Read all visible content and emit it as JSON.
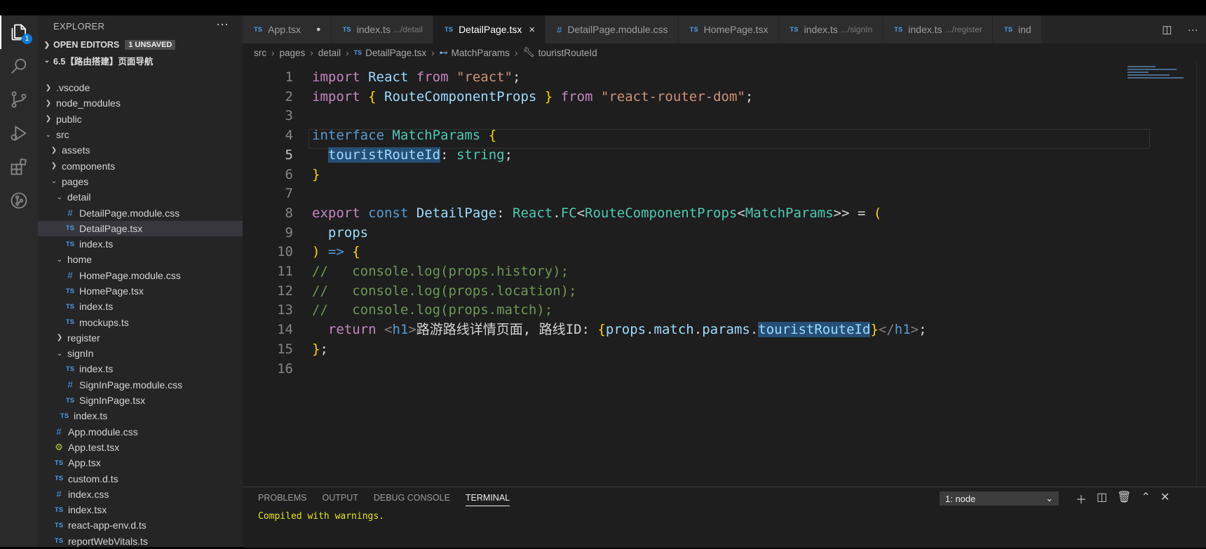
{
  "activity": {
    "badge": "1"
  },
  "sidebar": {
    "title": "EXPLORER",
    "more": "···",
    "open_editors": "OPEN EDITORS",
    "unsaved": "1 UNSAVED",
    "project": "6.5【路由搭建】页面导航",
    "tree": [
      {
        "label": ".vscode",
        "type": "folder",
        "open": false,
        "depth": 1
      },
      {
        "label": "node_modules",
        "type": "folder",
        "open": false,
        "depth": 1
      },
      {
        "label": "public",
        "type": "folder",
        "open": false,
        "depth": 1
      },
      {
        "label": "src",
        "type": "folder",
        "open": true,
        "depth": 1
      },
      {
        "label": "assets",
        "type": "folder",
        "open": false,
        "depth": 2
      },
      {
        "label": "components",
        "type": "folder",
        "open": false,
        "depth": 2
      },
      {
        "label": "pages",
        "type": "folder",
        "open": true,
        "depth": 2
      },
      {
        "label": "detail",
        "type": "folder",
        "open": true,
        "depth": 3
      },
      {
        "label": "DetailPage.module.css",
        "type": "css",
        "depth": 4
      },
      {
        "label": "DetailPage.tsx",
        "type": "ts",
        "depth": 4,
        "selected": true
      },
      {
        "label": "index.ts",
        "type": "ts",
        "depth": 4
      },
      {
        "label": "home",
        "type": "folder",
        "open": true,
        "depth": 3
      },
      {
        "label": "HomePage.module.css",
        "type": "css",
        "depth": 4
      },
      {
        "label": "HomePage.tsx",
        "type": "ts",
        "depth": 4
      },
      {
        "label": "index.ts",
        "type": "ts",
        "depth": 4
      },
      {
        "label": "mockups.ts",
        "type": "ts",
        "depth": 4
      },
      {
        "label": "register",
        "type": "folder",
        "open": false,
        "depth": 3
      },
      {
        "label": "signIn",
        "type": "folder",
        "open": true,
        "depth": 3
      },
      {
        "label": "index.ts",
        "type": "ts",
        "depth": 4
      },
      {
        "label": "SignInPage.module.css",
        "type": "css",
        "depth": 4
      },
      {
        "label": "SignInPage.tsx",
        "type": "ts",
        "depth": 4
      },
      {
        "label": "index.ts",
        "type": "ts",
        "depth": 3
      },
      {
        "label": "App.module.css",
        "type": "css",
        "depth": 2
      },
      {
        "label": "App.test.tsx",
        "type": "test",
        "depth": 2
      },
      {
        "label": "App.tsx",
        "type": "ts",
        "depth": 2
      },
      {
        "label": "custom.d.ts",
        "type": "ts",
        "depth": 2
      },
      {
        "label": "index.css",
        "type": "css",
        "depth": 2
      },
      {
        "label": "index.tsx",
        "type": "ts",
        "depth": 2
      },
      {
        "label": "react-app-env.d.ts",
        "type": "ts",
        "depth": 2
      },
      {
        "label": "reportWebVitals.ts",
        "type": "ts",
        "depth": 2
      }
    ]
  },
  "tabs": [
    {
      "label": "App.tsx",
      "icon": "TS",
      "sub": "",
      "dirty": true,
      "active": false
    },
    {
      "label": "index.ts",
      "icon": "TS",
      "sub": ".../detail",
      "active": false
    },
    {
      "label": "DetailPage.tsx",
      "icon": "TS",
      "sub": "",
      "active": true,
      "close": "×"
    },
    {
      "label": "DetailPage.module.css",
      "icon": "#",
      "sub": "",
      "active": false
    },
    {
      "label": "HomePage.tsx",
      "icon": "TS",
      "sub": "",
      "active": false
    },
    {
      "label": "index.ts",
      "icon": "TS",
      "sub": ".../signIn",
      "active": false
    },
    {
      "label": "index.ts",
      "icon": "TS",
      "sub": ".../register",
      "active": false
    },
    {
      "label": "ind",
      "icon": "TS",
      "sub": "",
      "active": false
    }
  ],
  "breadcrumb": {
    "items": [
      "src",
      "pages",
      "detail"
    ],
    "file_icon": "TS",
    "file": "DetailPage.tsx",
    "symbol": "MatchParams",
    "property": "touristRouteId"
  },
  "code": {
    "current_line": 5,
    "lines": [
      [
        [
          "kw2",
          "import"
        ],
        [
          "pn",
          " "
        ],
        [
          "vr",
          "React"
        ],
        [
          "pn",
          " "
        ],
        [
          "kw2",
          "from"
        ],
        [
          "pn",
          " "
        ],
        [
          "st",
          "\"react\""
        ],
        [
          "pn",
          ";"
        ]
      ],
      [
        [
          "kw2",
          "import"
        ],
        [
          "pn",
          " "
        ],
        [
          "br",
          "{"
        ],
        [
          "pn",
          " "
        ],
        [
          "vr",
          "RouteComponentProps"
        ],
        [
          "pn",
          " "
        ],
        [
          "br",
          "}"
        ],
        [
          "pn",
          " "
        ],
        [
          "kw2",
          "from"
        ],
        [
          "pn",
          " "
        ],
        [
          "st",
          "\"react-router-dom\""
        ],
        [
          "pn",
          ";"
        ]
      ],
      [],
      [
        [
          "kw",
          "interface"
        ],
        [
          "pn",
          " "
        ],
        [
          "ty",
          "MatchParams"
        ],
        [
          "pn",
          " "
        ],
        [
          "br",
          "{"
        ]
      ],
      [
        [
          "pn",
          "  "
        ],
        [
          "vr hl",
          "touristRouteId"
        ],
        [
          "pn",
          ": "
        ],
        [
          "ty",
          "string"
        ],
        [
          "pn",
          ";"
        ]
      ],
      [
        [
          "br",
          "}"
        ]
      ],
      [],
      [
        [
          "kw2",
          "export"
        ],
        [
          "pn",
          " "
        ],
        [
          "kw",
          "const"
        ],
        [
          "pn",
          " "
        ],
        [
          "vr",
          "DetailPage"
        ],
        [
          "pn",
          ": "
        ],
        [
          "ty",
          "React"
        ],
        [
          "pn",
          "."
        ],
        [
          "ty",
          "FC"
        ],
        [
          "pn",
          "<"
        ],
        [
          "ty",
          "RouteComponentProps"
        ],
        [
          "pn",
          "<"
        ],
        [
          "ty",
          "MatchParams"
        ],
        [
          "pn",
          ">> = "
        ],
        [
          "br",
          "("
        ]
      ],
      [
        [
          "pn",
          "  "
        ],
        [
          "vr",
          "props"
        ]
      ],
      [
        [
          "br",
          ")"
        ],
        [
          "pn",
          " "
        ],
        [
          "kw",
          "=>"
        ],
        [
          "pn",
          " "
        ],
        [
          "br",
          "{"
        ]
      ],
      [
        [
          "cm",
          "//   console.log(props.history);"
        ]
      ],
      [
        [
          "cm",
          "//   console.log(props.location);"
        ]
      ],
      [
        [
          "cm",
          "//   console.log(props.match);"
        ]
      ],
      [
        [
          "pn",
          "  "
        ],
        [
          "kw2",
          "return"
        ],
        [
          "pn",
          " "
        ],
        [
          "tg",
          "<"
        ],
        [
          "tgn",
          "h1"
        ],
        [
          "tg",
          ">"
        ],
        [
          "pn",
          "路游路线详情页面, 路线ID: "
        ],
        [
          "br",
          "{"
        ],
        [
          "vr",
          "props"
        ],
        [
          "pn",
          "."
        ],
        [
          "vr",
          "match"
        ],
        [
          "pn",
          "."
        ],
        [
          "vr",
          "params"
        ],
        [
          "pn",
          "."
        ],
        [
          "vr hl",
          "touristRouteId"
        ],
        [
          "br",
          "}"
        ],
        [
          "tg",
          "</"
        ],
        [
          "tgn",
          "h1"
        ],
        [
          "tg",
          ">"
        ],
        [
          "pn",
          ";"
        ]
      ],
      [
        [
          "br",
          "}"
        ],
        [
          "pn",
          ";"
        ]
      ],
      []
    ]
  },
  "panel": {
    "tabs": [
      "PROBLEMS",
      "OUTPUT",
      "DEBUG CONSOLE",
      "TERMINAL"
    ],
    "active": "TERMINAL",
    "terminal_select": "1: node",
    "output": "Compiled with warnings."
  }
}
